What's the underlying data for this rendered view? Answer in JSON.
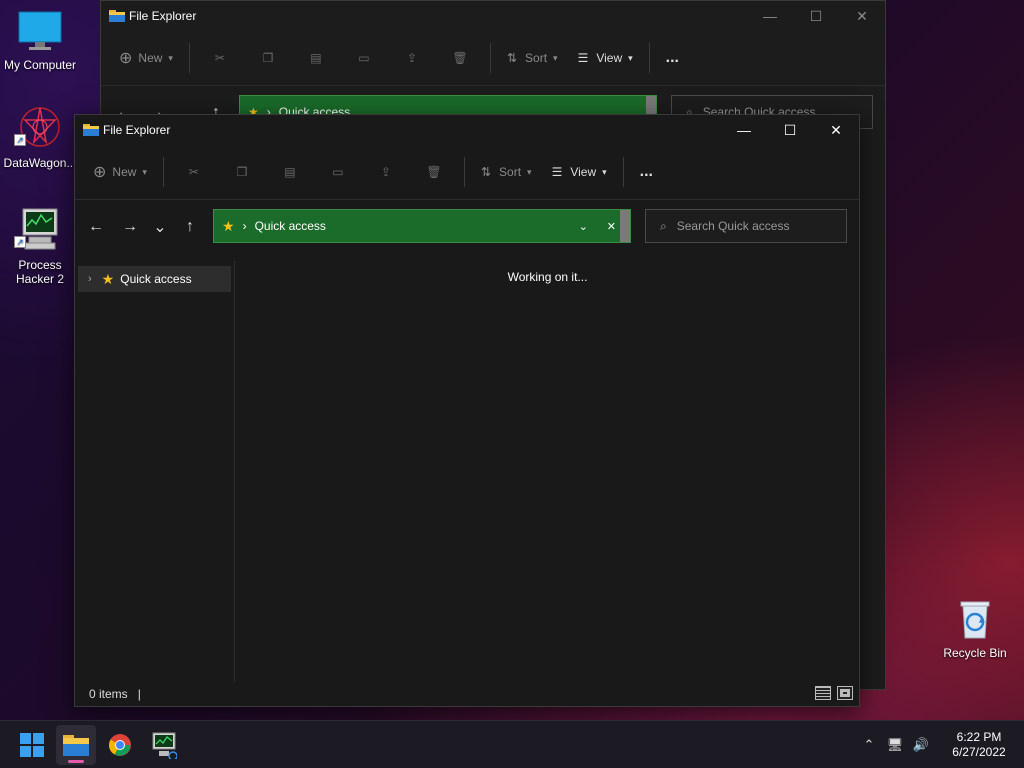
{
  "desktop": {
    "icons": [
      {
        "label": "My Computer"
      },
      {
        "label": "DataWagon..."
      },
      {
        "label": "Process Hacker 2"
      },
      {
        "label": "Recycle Bin"
      }
    ]
  },
  "back_window": {
    "title": "File Explorer",
    "toolbar": {
      "new": "New",
      "sort": "Sort",
      "view": "View",
      "more": "..."
    },
    "address": {
      "location": "Quick access"
    },
    "search": {
      "placeholder": "Search Quick access"
    }
  },
  "front_window": {
    "title": "File Explorer",
    "toolbar": {
      "new": "New",
      "sort": "Sort",
      "view": "View",
      "more": "..."
    },
    "address": {
      "location": "Quick access"
    },
    "search": {
      "placeholder": "Search Quick access"
    },
    "sidebar": {
      "items": [
        {
          "label": "Quick access"
        }
      ]
    },
    "content": {
      "message": "Working on it..."
    },
    "status": {
      "items": "0 items"
    }
  },
  "taskbar": {
    "clock": {
      "time": "6:22 PM",
      "date": "6/27/2022"
    }
  },
  "colors": {
    "address_bg": "#1b6b2a",
    "accent_pink": "#e55aa8",
    "star": "#f2c21b"
  }
}
